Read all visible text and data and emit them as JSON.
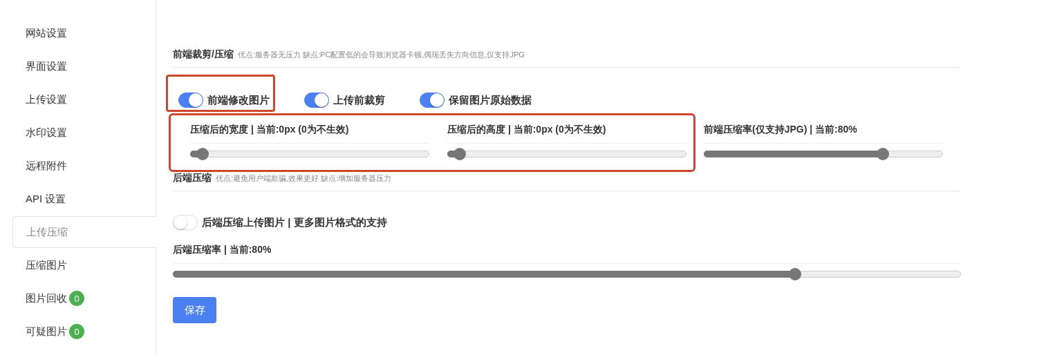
{
  "sidebar": {
    "items": [
      {
        "label": "网站设置",
        "selected": false
      },
      {
        "label": "界面设置",
        "selected": false
      },
      {
        "label": "上传设置",
        "selected": false
      },
      {
        "label": "水印设置",
        "selected": false
      },
      {
        "label": "远程附件",
        "selected": false
      },
      {
        "label": "API 设置",
        "selected": false
      },
      {
        "label": "上传压缩",
        "selected": true
      },
      {
        "label": "压缩图片",
        "selected": false
      },
      {
        "label": "图片回收",
        "selected": false,
        "badge": "0"
      },
      {
        "label": "可疑图片",
        "selected": false,
        "badge": "0"
      }
    ]
  },
  "frontend": {
    "title": "前端裁剪/压缩",
    "hint": "优点:服务器无压力 缺点:PC配置低的会导致浏览器卡顿,偶现丢失方向信息,仅支持JPG",
    "toggles": [
      {
        "label": "前端修改图片",
        "on": true,
        "highlighted": true
      },
      {
        "label": "上传前裁剪",
        "on": true,
        "highlighted": false
      },
      {
        "label": "保留图片原始数据",
        "on": true,
        "highlighted": false
      }
    ],
    "size_sliders_highlighted": true,
    "sliders": [
      {
        "label": "压缩后的宽度 | 当前:0px (0为不生效)",
        "level": 0.05
      },
      {
        "label": "压缩后的高度 | 当前:0px (0为不生效)",
        "level": 0.05
      },
      {
        "label": "前端压缩率(仅支持JPG) | 当前:80%",
        "level": 0.75
      }
    ]
  },
  "backend": {
    "title": "后端压缩",
    "hint": "优点:避免用户端欺骗,效果更好 缺点:增加服务器压力",
    "toggle": {
      "label": "后端压缩上传图片 | 更多图片格式的支持",
      "on": false
    },
    "slider": {
      "label": "后端压缩率 | 当前:80%",
      "level": 0.79
    }
  },
  "save_button": "保存"
}
